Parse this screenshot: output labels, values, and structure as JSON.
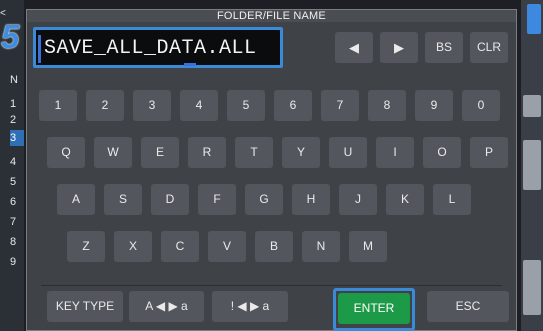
{
  "background": {
    "left_numbers": [
      "1",
      "2",
      "3",
      "4",
      "5",
      "6",
      "7",
      "8",
      "9"
    ],
    "left_top_char": "N",
    "highlighted_row": "3",
    "nav_arrow": "<"
  },
  "dialog": {
    "title": "FOLDER/FILE NAME",
    "step_marker": "5",
    "filename": "SAVE_ALL_DATA.ALL",
    "controls": {
      "left_arrow": "◀",
      "right_arrow": "▶",
      "backspace": "BS",
      "clear": "CLR"
    },
    "rows": {
      "digits": [
        "1",
        "2",
        "3",
        "4",
        "5",
        "6",
        "7",
        "8",
        "9",
        "0"
      ],
      "row_q": [
        "Q",
        "W",
        "E",
        "R",
        "T",
        "Y",
        "U",
        "I",
        "O",
        "P"
      ],
      "row_a": [
        "A",
        "S",
        "D",
        "F",
        "G",
        "H",
        "J",
        "K",
        "L"
      ],
      "row_z": [
        "Z",
        "X",
        "C",
        "V",
        "B",
        "N",
        "M"
      ]
    },
    "bottom": {
      "key_type": "KEY TYPE",
      "alpha_toggle": "A ◀ ▶ a",
      "symbol_toggle": "! ◀ ▶ a",
      "enter": "ENTER",
      "esc": "ESC"
    }
  },
  "colors": {
    "accent_blue": "#3b8ad8",
    "enter_green": "#1d9a48",
    "key_gray": "#53575d"
  }
}
